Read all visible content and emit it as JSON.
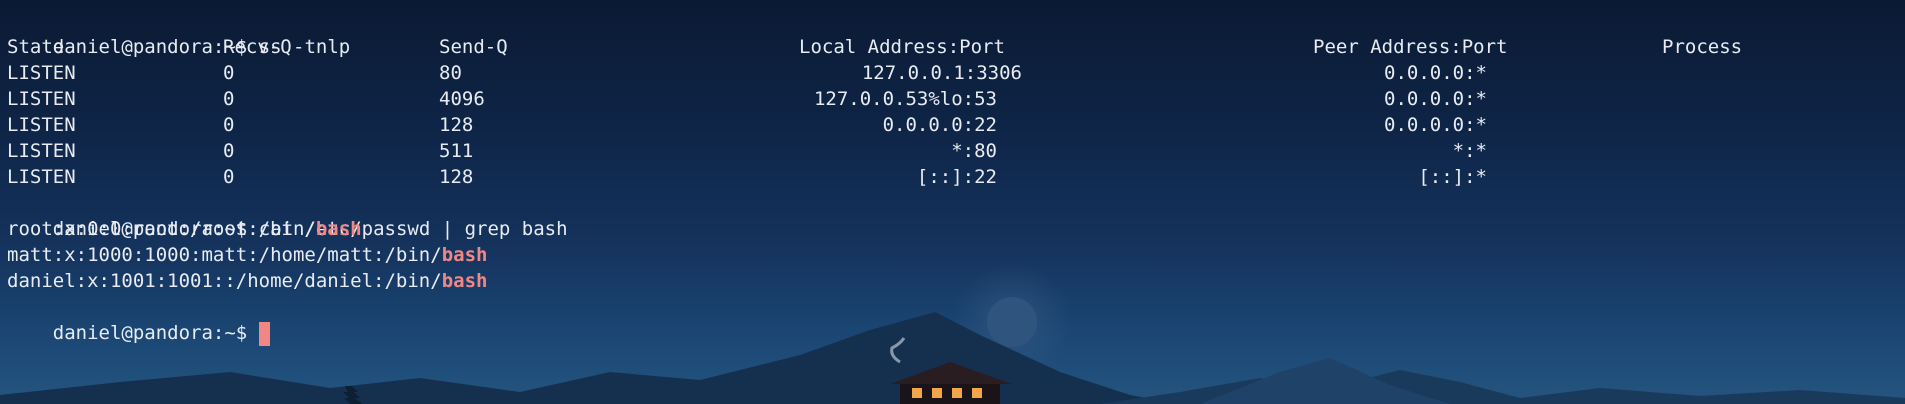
{
  "prompt": "daniel@pandora:~$",
  "commands": {
    "first": "ss -tnlp",
    "second": "cat /etc/passwd | grep bash"
  },
  "ss_table": {
    "headers": {
      "state": "State",
      "recvq": "Recv-Q",
      "sendq": "Send-Q",
      "local": "Local Address:Port",
      "peer": "Peer Address:Port",
      "process": "Process"
    },
    "rows": [
      {
        "state": "LISTEN",
        "recvq": "0",
        "sendq": "80",
        "local": "127.0.0.1:3306",
        "peer": "0.0.0.0:*"
      },
      {
        "state": "LISTEN",
        "recvq": "0",
        "sendq": "4096",
        "local": "127.0.0.53%lo:53",
        "peer": "0.0.0.0:*"
      },
      {
        "state": "LISTEN",
        "recvq": "0",
        "sendq": "128",
        "local": "0.0.0.0:22",
        "peer": "0.0.0.0:*"
      },
      {
        "state": "LISTEN",
        "recvq": "0",
        "sendq": "511",
        "local": "*:80",
        "peer": "*:*"
      },
      {
        "state": "LISTEN",
        "recvq": "0",
        "sendq": "128",
        "local": "[::]:22",
        "peer": "[::]:*"
      }
    ]
  },
  "grep_results": [
    {
      "prefix": "root:x:0:0:root:/root:/bin/",
      "match": "bash"
    },
    {
      "prefix": "matt:x:1000:1000:matt:/home/matt:/bin/",
      "match": "bash"
    },
    {
      "prefix": "daniel:x:1001:1001::/home/daniel:/bin/",
      "match": "bash"
    }
  ],
  "colors": {
    "highlight": "#f08785",
    "text": "#e8ecf2",
    "background": "#0e2446"
  },
  "wallpaper": {
    "scene": "night mountain landscape with moon",
    "icons": [
      "moon-icon",
      "mountain-icon",
      "house-icon",
      "tree-icon"
    ]
  }
}
